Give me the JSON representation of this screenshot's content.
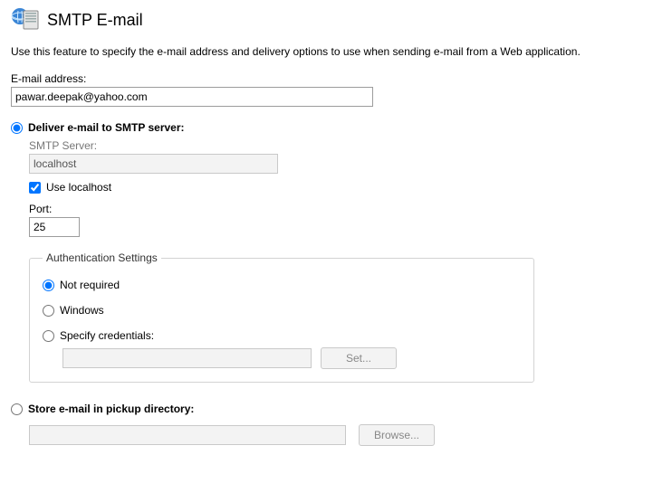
{
  "header": {
    "title": "SMTP E-mail"
  },
  "description": "Use this feature to specify the e-mail address and delivery options to use when sending e-mail from a Web application.",
  "email": {
    "label": "E-mail address:",
    "value": "pawar.deepak@yahoo.com"
  },
  "delivery": {
    "smtp_option_label": "Deliver e-mail to SMTP server:",
    "smtp_server_label": "SMTP Server:",
    "smtp_server_value": "localhost",
    "use_localhost_label": "Use localhost",
    "port_label": "Port:",
    "port_value": "25"
  },
  "auth": {
    "legend": "Authentication Settings",
    "not_required_label": "Not required",
    "windows_label": "Windows",
    "specify_label": "Specify credentials:",
    "set_button": "Set..."
  },
  "pickup": {
    "option_label": "Store e-mail in pickup directory:",
    "browse_button": "Browse..."
  }
}
